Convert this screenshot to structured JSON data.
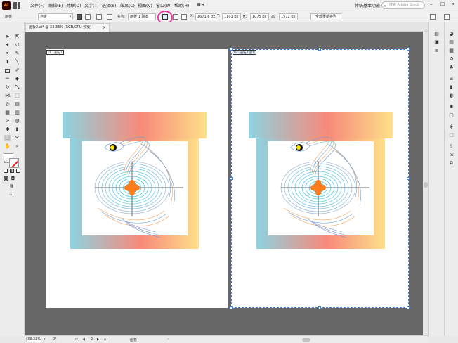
{
  "menubar": {
    "app_logo": "Ai",
    "items": [
      "文件(F)",
      "编辑(E)",
      "对象(O)",
      "文字(T)",
      "选择(S)",
      "效果(C)",
      "视图(V)",
      "窗口(W)",
      "帮助(H)"
    ],
    "workspace": "传统基本功能",
    "search_placeholder": "搜索 Adobe Stock"
  },
  "ctrlbar": {
    "panel_label": "画板",
    "preset": "自定",
    "name_label": "名称:",
    "name_value": "画板 1 副本",
    "x_label": "X:",
    "x_value": "1671.6 px",
    "y_label": "Y:",
    "y_value": "1101 px",
    "w_label": "宽:",
    "w_value": "1075 px",
    "h_label": "高:",
    "h_value": "1572 px",
    "rearrange_button": "全部重新排列"
  },
  "document": {
    "tab_title": "画板2.ai* @ 33.33% (RGB/GPU 预览)",
    "close_glyph": "×"
  },
  "artboards": [
    {
      "label": "01 - 画板 1"
    },
    {
      "label": "02 - 画板 1 副本"
    }
  ],
  "statusbar": {
    "zoom": "33.33%",
    "rotation": "0°",
    "artboard_nav": "2",
    "status": "画板"
  },
  "colors": {
    "gradient_start": "#8dd3e0",
    "gradient_mid": "#f8897a",
    "gradient_end": "#fde08a",
    "accent_orange": "#ff7d1a",
    "ring_highlight": "#e23aa0",
    "canvas_bg": "#676767",
    "selection_blue": "#3f7fe4"
  }
}
